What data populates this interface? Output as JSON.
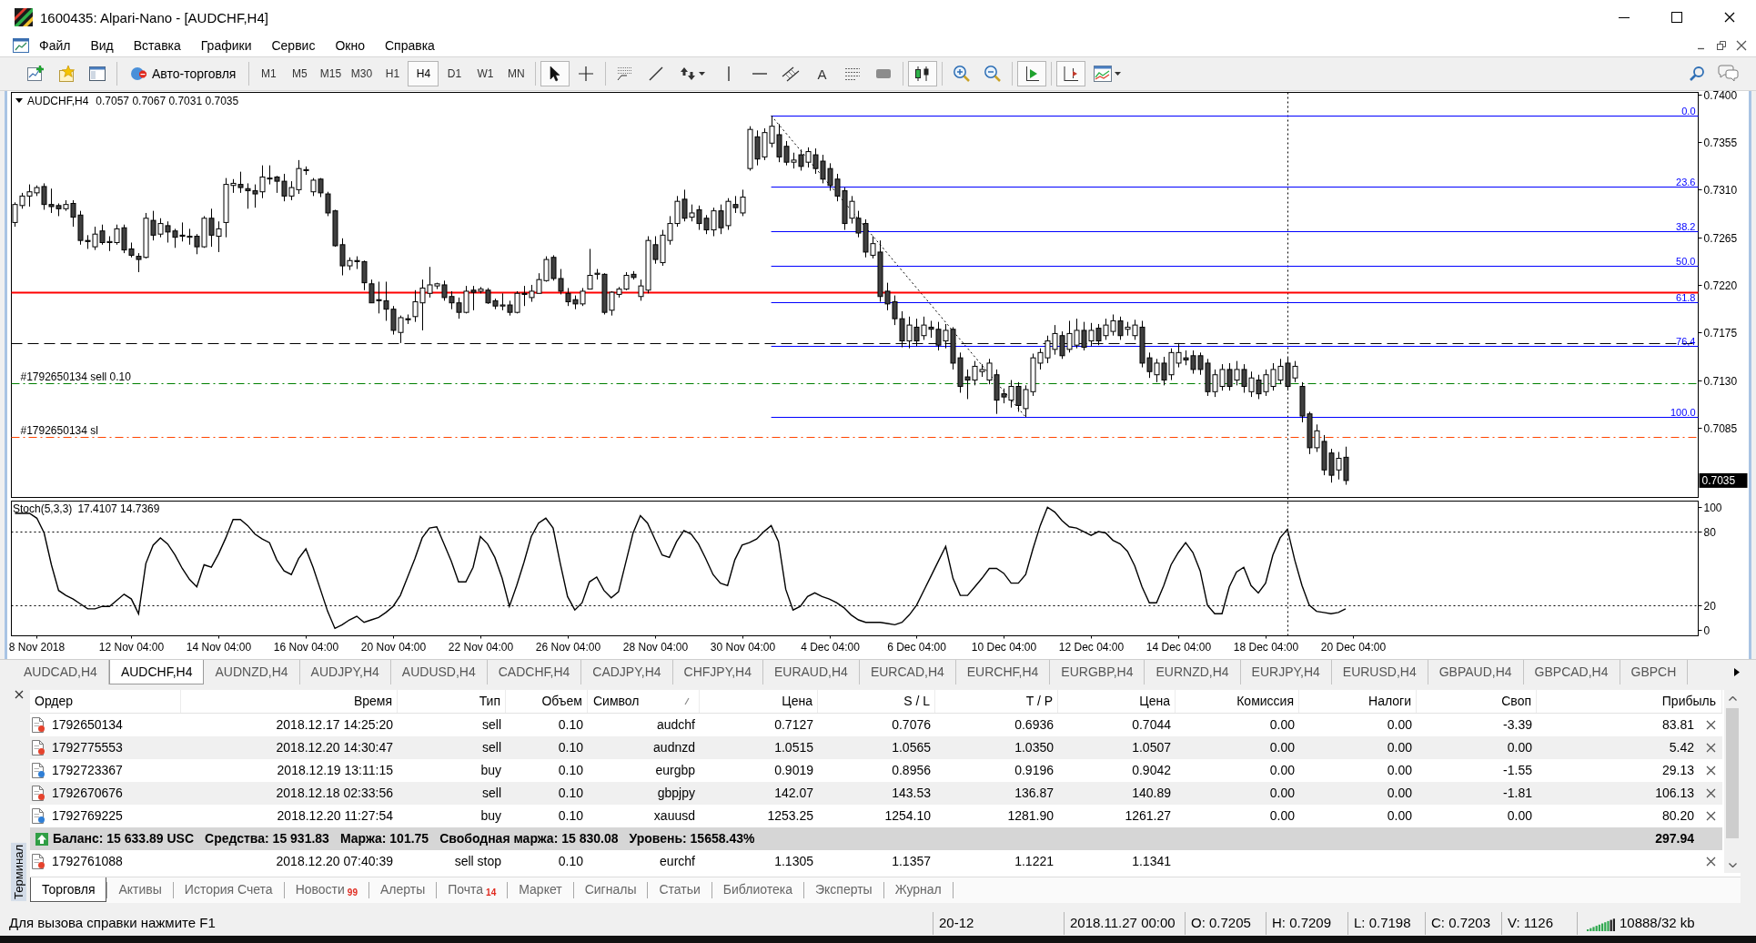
{
  "window": {
    "title": "1600435: Alpari-Nano - [AUDCHF,H4]"
  },
  "menu": [
    "Файл",
    "Вид",
    "Вставка",
    "Графики",
    "Сервис",
    "Окно",
    "Справка"
  ],
  "toolbar": {
    "auto_trading": "Авто-торговля",
    "timeframes": [
      {
        "label": "M1",
        "selected": false
      },
      {
        "label": "M5",
        "selected": false
      },
      {
        "label": "M15",
        "selected": false
      },
      {
        "label": "M30",
        "selected": false
      },
      {
        "label": "H1",
        "selected": false
      },
      {
        "label": "H4",
        "selected": true
      },
      {
        "label": "D1",
        "selected": false
      },
      {
        "label": "W1",
        "selected": false
      },
      {
        "label": "MN",
        "selected": false
      }
    ],
    "cursor_tools": [
      {
        "selected": true
      },
      {
        "selected": false
      }
    ],
    "text_tool": "A",
    "toggles": [
      {
        "on": true
      },
      {
        "on": true
      },
      {
        "on": true
      }
    ]
  },
  "chart": {
    "header": {
      "symbol": "AUDCHF,H4",
      "prices": "0.7057 0.7067 0.7031 0.7035"
    },
    "chart_data": [
      {
        "type": "candlestick",
        "ylim": [
          0.7019,
          0.7402
        ],
        "tick_labels": "y",
        "yticks": [
          {
            "value": 0.74,
            "label": "0.7400"
          },
          {
            "value": 0.7355,
            "label": "0.7355"
          },
          {
            "value": 0.731,
            "label": "0.7310"
          },
          {
            "value": 0.7265,
            "label": "0.7265"
          },
          {
            "value": 0.722,
            "label": "0.7220"
          },
          {
            "value": 0.7175,
            "label": "0.7175"
          },
          {
            "value": 0.713,
            "label": "0.7130"
          },
          {
            "value": 0.7085,
            "label": "0.7085"
          }
        ],
        "ref_lines": [
          {
            "axis": "y",
            "value": 0.738,
            "color": "#0000ff",
            "line_style": "solid"
          },
          {
            "axis": "y",
            "value": 0.7313,
            "color": "#0000ff",
            "line_style": "solid"
          },
          {
            "axis": "y",
            "value": 0.7271,
            "color": "#0000ff",
            "line_style": "solid"
          },
          {
            "axis": "y",
            "value": 0.7238,
            "color": "#0000ff",
            "line_style": "solid"
          },
          {
            "axis": "y",
            "value": 0.7204,
            "color": "#0000ff",
            "line_style": "solid"
          },
          {
            "axis": "y",
            "value": 0.7162,
            "color": "#0000ff",
            "line_style": "solid"
          },
          {
            "axis": "y",
            "value": 0.7095,
            "color": "#0000ff",
            "line_style": "solid"
          },
          {
            "axis": "y",
            "value": 0.7213,
            "color": "#ff0000",
            "line_style": "solid"
          },
          {
            "axis": "y",
            "value": 0.7165,
            "color": "#000000",
            "line_style": "dashed"
          },
          {
            "axis": "y",
            "value": 0.7127,
            "label": "#1792650134 sell 0.10",
            "color": "#008000",
            "line_style": "dashdot"
          },
          {
            "axis": "y",
            "value": 0.7076,
            "label": "#1792650134 sl",
            "color": "#ff4500",
            "line_style": "dashdot"
          }
        ],
        "annotations": [
          "0.0",
          "23.6",
          "38.2",
          "50.0",
          "61.8",
          "76,4",
          "100.0",
          "0.7035"
        ],
        "ohlc": [
          [
            0.7279,
            0.7298,
            0.7275,
            0.7296
          ],
          [
            0.7295,
            0.7307,
            0.7292,
            0.7304
          ],
          [
            0.7304,
            0.7315,
            0.7294,
            0.7308
          ],
          [
            0.7307,
            0.7314,
            0.7304,
            0.7312
          ],
          [
            0.7313,
            0.7316,
            0.7291,
            0.7296
          ],
          [
            0.7296,
            0.7311,
            0.7288,
            0.7294
          ],
          [
            0.7295,
            0.7297,
            0.7285,
            0.7292
          ],
          [
            0.7292,
            0.73,
            0.729,
            0.7296
          ],
          [
            0.7297,
            0.73,
            0.7275,
            0.7284
          ],
          [
            0.7286,
            0.729,
            0.7258,
            0.7262
          ],
          [
            0.7262,
            0.7267,
            0.7254,
            0.7261
          ],
          [
            0.7256,
            0.7275,
            0.7253,
            0.7268
          ],
          [
            0.7271,
            0.7277,
            0.7258,
            0.726
          ],
          [
            0.726,
            0.7266,
            0.7252,
            0.7261
          ],
          [
            0.726,
            0.7277,
            0.7258,
            0.7273
          ],
          [
            0.7274,
            0.7277,
            0.725,
            0.7253
          ],
          [
            0.7254,
            0.726,
            0.7246,
            0.7248
          ],
          [
            0.7247,
            0.725,
            0.7232,
            0.7244
          ],
          [
            0.7246,
            0.7288,
            0.7245,
            0.7283
          ],
          [
            0.7281,
            0.729,
            0.7262,
            0.7267
          ],
          [
            0.7268,
            0.7283,
            0.7265,
            0.7278
          ],
          [
            0.7276,
            0.728,
            0.726,
            0.727
          ],
          [
            0.7271,
            0.7273,
            0.7255,
            0.7265
          ],
          [
            0.7267,
            0.7279,
            0.7261,
            0.7266
          ],
          [
            0.7265,
            0.7273,
            0.7258,
            0.7266
          ],
          [
            0.7266,
            0.7268,
            0.7249,
            0.7256
          ],
          [
            0.7256,
            0.7285,
            0.7255,
            0.7283
          ],
          [
            0.7283,
            0.7292,
            0.7256,
            0.7267
          ],
          [
            0.7266,
            0.728,
            0.7251,
            0.7273
          ],
          [
            0.7279,
            0.7321,
            0.7265,
            0.7315
          ],
          [
            0.7314,
            0.732,
            0.7307,
            0.7316
          ],
          [
            0.7315,
            0.7327,
            0.7307,
            0.7312
          ],
          [
            0.7311,
            0.7316,
            0.7292,
            0.7309
          ],
          [
            0.7309,
            0.7315,
            0.7293,
            0.7306
          ],
          [
            0.7308,
            0.7333,
            0.7302,
            0.7322
          ],
          [
            0.7321,
            0.7333,
            0.7315,
            0.7321
          ],
          [
            0.7322,
            0.7323,
            0.7307,
            0.7318
          ],
          [
            0.7318,
            0.7325,
            0.7299,
            0.7304
          ],
          [
            0.7304,
            0.7318,
            0.73,
            0.7312
          ],
          [
            0.731,
            0.7338,
            0.7306,
            0.733
          ],
          [
            0.7329,
            0.7332,
            0.7324,
            0.7328
          ],
          [
            0.7308,
            0.7321,
            0.7304,
            0.7319
          ],
          [
            0.732,
            0.7321,
            0.7303,
            0.7307
          ],
          [
            0.7306,
            0.7308,
            0.7285,
            0.7288
          ],
          [
            0.729,
            0.7291,
            0.7256,
            0.7257
          ],
          [
            0.7258,
            0.7264,
            0.7229,
            0.7238
          ],
          [
            0.7238,
            0.7246,
            0.7234,
            0.7243
          ],
          [
            0.7243,
            0.7247,
            0.7235,
            0.7242
          ],
          [
            0.7242,
            0.7243,
            0.7215,
            0.7222
          ],
          [
            0.7221,
            0.7225,
            0.7203,
            0.7203
          ],
          [
            0.7206,
            0.7223,
            0.7193,
            0.7205
          ],
          [
            0.7205,
            0.7223,
            0.7186,
            0.7197
          ],
          [
            0.7197,
            0.72,
            0.7173,
            0.7177
          ],
          [
            0.7175,
            0.7191,
            0.7165,
            0.7189
          ],
          [
            0.7188,
            0.7192,
            0.7183,
            0.7187
          ],
          [
            0.719,
            0.7215,
            0.7185,
            0.7204
          ],
          [
            0.7203,
            0.7225,
            0.7177,
            0.7217
          ],
          [
            0.7212,
            0.7237,
            0.7208,
            0.722
          ],
          [
            0.7219,
            0.7222,
            0.7216,
            0.7221
          ],
          [
            0.722,
            0.7224,
            0.7205,
            0.7208
          ],
          [
            0.7209,
            0.7214,
            0.7197,
            0.7203
          ],
          [
            0.7203,
            0.7208,
            0.7188,
            0.7194
          ],
          [
            0.7194,
            0.7219,
            0.7193,
            0.7214
          ],
          [
            0.7215,
            0.7219,
            0.7196,
            0.7213
          ],
          [
            0.7214,
            0.7218,
            0.7212,
            0.7216
          ],
          [
            0.7215,
            0.7217,
            0.7202,
            0.7203
          ],
          [
            0.7205,
            0.7207,
            0.7197,
            0.72
          ],
          [
            0.72,
            0.7212,
            0.7196,
            0.7201
          ],
          [
            0.7201,
            0.7205,
            0.7191,
            0.7194
          ],
          [
            0.7194,
            0.7214,
            0.7193,
            0.7212
          ],
          [
            0.7212,
            0.7219,
            0.72,
            0.7211
          ],
          [
            0.7208,
            0.722,
            0.7204,
            0.7214
          ],
          [
            0.7212,
            0.7231,
            0.7212,
            0.7225
          ],
          [
            0.7224,
            0.7247,
            0.7223,
            0.7244
          ],
          [
            0.7246,
            0.7248,
            0.7224,
            0.7226
          ],
          [
            0.7226,
            0.7235,
            0.7211,
            0.7214
          ],
          [
            0.7212,
            0.7217,
            0.72,
            0.7204
          ],
          [
            0.7206,
            0.721,
            0.7197,
            0.7202
          ],
          [
            0.7202,
            0.7217,
            0.72,
            0.7214
          ],
          [
            0.7216,
            0.7254,
            0.7216,
            0.7229
          ],
          [
            0.723,
            0.7235,
            0.7225,
            0.7231
          ],
          [
            0.723,
            0.7231,
            0.7192,
            0.7194
          ],
          [
            0.7196,
            0.7214,
            0.7191,
            0.7213
          ],
          [
            0.7211,
            0.7218,
            0.7208,
            0.7216
          ],
          [
            0.7216,
            0.7232,
            0.7215,
            0.7229
          ],
          [
            0.723,
            0.7233,
            0.7225,
            0.7227
          ],
          [
            0.7209,
            0.7225,
            0.7205,
            0.7219
          ],
          [
            0.7215,
            0.7266,
            0.7212,
            0.7262
          ],
          [
            0.7258,
            0.7266,
            0.724,
            0.7244
          ],
          [
            0.7241,
            0.7272,
            0.7238,
            0.7267
          ],
          [
            0.7262,
            0.7285,
            0.7258,
            0.7278
          ],
          [
            0.7278,
            0.7304,
            0.7275,
            0.7299
          ],
          [
            0.7301,
            0.731,
            0.728,
            0.7283
          ],
          [
            0.7284,
            0.7296,
            0.728,
            0.7288
          ],
          [
            0.7291,
            0.7295,
            0.7272,
            0.7278
          ],
          [
            0.7283,
            0.7286,
            0.7268,
            0.7272
          ],
          [
            0.7272,
            0.7293,
            0.7266,
            0.729
          ],
          [
            0.729,
            0.7296,
            0.7268,
            0.7274
          ],
          [
            0.7276,
            0.7302,
            0.7272,
            0.7299
          ],
          [
            0.7296,
            0.7304,
            0.7288,
            0.7293
          ],
          [
            0.7288,
            0.731,
            0.7285,
            0.7303
          ],
          [
            0.733,
            0.737,
            0.7328,
            0.7367
          ],
          [
            0.736,
            0.7366,
            0.7333,
            0.7339
          ],
          [
            0.7341,
            0.7368,
            0.7338,
            0.7364
          ],
          [
            0.7354,
            0.738,
            0.735,
            0.737
          ],
          [
            0.7362,
            0.7372,
            0.7336,
            0.7341
          ],
          [
            0.7351,
            0.7356,
            0.7333,
            0.7336
          ],
          [
            0.7336,
            0.7345,
            0.733,
            0.7338
          ],
          [
            0.7343,
            0.7348,
            0.7328,
            0.7332
          ],
          [
            0.7336,
            0.735,
            0.7331,
            0.7346
          ],
          [
            0.7343,
            0.7349,
            0.7325,
            0.733
          ],
          [
            0.7337,
            0.7343,
            0.7316,
            0.732
          ],
          [
            0.733,
            0.7335,
            0.7309,
            0.7314
          ],
          [
            0.732,
            0.7325,
            0.7299,
            0.7304
          ],
          [
            0.7309,
            0.7312,
            0.7272,
            0.7278
          ],
          [
            0.7283,
            0.7304,
            0.7278,
            0.7299
          ],
          [
            0.7283,
            0.729,
            0.7265,
            0.7269
          ],
          [
            0.7278,
            0.7282,
            0.7246,
            0.7251
          ],
          [
            0.7248,
            0.7266,
            0.7245,
            0.7259
          ],
          [
            0.7251,
            0.7262,
            0.7204,
            0.7209
          ],
          [
            0.7214,
            0.7222,
            0.7196,
            0.7202
          ],
          [
            0.7204,
            0.721,
            0.7182,
            0.7188
          ],
          [
            0.7188,
            0.7195,
            0.7161,
            0.7167
          ],
          [
            0.7167,
            0.719,
            0.716,
            0.7182
          ],
          [
            0.718,
            0.7188,
            0.7162,
            0.7167
          ],
          [
            0.7172,
            0.719,
            0.7168,
            0.7182
          ],
          [
            0.718,
            0.7186,
            0.717,
            0.7178
          ],
          [
            0.7178,
            0.7185,
            0.7158,
            0.7163
          ],
          [
            0.7167,
            0.7183,
            0.716,
            0.7177
          ],
          [
            0.7178,
            0.718,
            0.714,
            0.7146
          ],
          [
            0.7151,
            0.7156,
            0.7118,
            0.7124
          ],
          [
            0.7133,
            0.714,
            0.7112,
            0.713
          ],
          [
            0.713,
            0.7148,
            0.7125,
            0.7143
          ],
          [
            0.7138,
            0.7145,
            0.7133,
            0.714
          ],
          [
            0.713,
            0.715,
            0.7126,
            0.7146
          ],
          [
            0.7135,
            0.714,
            0.7098,
            0.7111
          ],
          [
            0.7117,
            0.7122,
            0.7108,
            0.7114
          ],
          [
            0.7111,
            0.713,
            0.7104,
            0.7124
          ],
          [
            0.7124,
            0.7128,
            0.71,
            0.7106
          ],
          [
            0.7103,
            0.7125,
            0.7095,
            0.7121
          ],
          [
            0.7119,
            0.7155,
            0.7115,
            0.7151
          ],
          [
            0.7146,
            0.716,
            0.714,
            0.7156
          ],
          [
            0.7151,
            0.7172,
            0.7146,
            0.7167
          ],
          [
            0.7159,
            0.7182,
            0.7154,
            0.7174
          ],
          [
            0.7172,
            0.7176,
            0.715,
            0.7153
          ],
          [
            0.7159,
            0.7186,
            0.7156,
            0.7174
          ],
          [
            0.7163,
            0.7188,
            0.716,
            0.7177
          ],
          [
            0.7177,
            0.7185,
            0.7158,
            0.7161
          ],
          [
            0.7167,
            0.7184,
            0.7162,
            0.7177
          ],
          [
            0.7179,
            0.7183,
            0.7163,
            0.7167
          ],
          [
            0.7172,
            0.7188,
            0.7168,
            0.7182
          ],
          [
            0.7176,
            0.7192,
            0.7172,
            0.7186
          ],
          [
            0.7186,
            0.719,
            0.7168,
            0.7172
          ],
          [
            0.7178,
            0.7185,
            0.7172,
            0.718
          ],
          [
            0.7172,
            0.7187,
            0.7168,
            0.7182
          ],
          [
            0.718,
            0.7186,
            0.7142,
            0.7146
          ],
          [
            0.7151,
            0.7156,
            0.7132,
            0.7138
          ],
          [
            0.7135,
            0.715,
            0.7128,
            0.7146
          ],
          [
            0.7146,
            0.7152,
            0.7125,
            0.713
          ],
          [
            0.7135,
            0.716,
            0.713,
            0.7156
          ],
          [
            0.7146,
            0.7165,
            0.7142,
            0.7156
          ],
          [
            0.7151,
            0.7158,
            0.7144,
            0.7149
          ],
          [
            0.7153,
            0.7158,
            0.7136,
            0.714
          ],
          [
            0.7153,
            0.7156,
            0.7135,
            0.714
          ],
          [
            0.7146,
            0.715,
            0.7115,
            0.7119
          ],
          [
            0.7119,
            0.714,
            0.7114,
            0.7135
          ],
          [
            0.7124,
            0.7145,
            0.712,
            0.714
          ],
          [
            0.714,
            0.7146,
            0.712,
            0.7124
          ],
          [
            0.713,
            0.7148,
            0.7125,
            0.714
          ],
          [
            0.714,
            0.7145,
            0.7118,
            0.7124
          ],
          [
            0.7119,
            0.7138,
            0.7114,
            0.7132
          ],
          [
            0.713,
            0.7135,
            0.7112,
            0.7117
          ],
          [
            0.7119,
            0.714,
            0.7115,
            0.7135
          ],
          [
            0.7124,
            0.7146,
            0.712,
            0.714
          ],
          [
            0.713,
            0.715,
            0.7126,
            0.7143
          ],
          [
            0.7146,
            0.7152,
            0.712,
            0.7124
          ],
          [
            0.7132,
            0.7148,
            0.7128,
            0.7143
          ],
          [
            0.7124,
            0.7128,
            0.709,
            0.7096
          ],
          [
            0.7098,
            0.71,
            0.706,
            0.7066
          ],
          [
            0.7066,
            0.7088,
            0.7062,
            0.7082
          ],
          [
            0.7072,
            0.7078,
            0.704,
            0.7045
          ],
          [
            0.7061,
            0.7065,
            0.7033,
            0.704
          ],
          [
            0.7045,
            0.7062,
            0.7036,
            0.7056
          ],
          [
            0.7057,
            0.7067,
            0.7031,
            0.7035
          ],
          null,
          null,
          null,
          null,
          null,
          null,
          null,
          null,
          null,
          null,
          null,
          null,
          null,
          null,
          null,
          null,
          null,
          null,
          null,
          null,
          null,
          null,
          null,
          null,
          null,
          null,
          null,
          null,
          null,
          null,
          null,
          null,
          null,
          null,
          null,
          null,
          null,
          null,
          null,
          null,
          null,
          null,
          null,
          null,
          null,
          null,
          null,
          null
        ]
      },
      {
        "type": "line",
        "title": "Stoch(5,3,3)",
        "subtitle": "17.4107 14.7369",
        "ylim": [
          -5,
          105
        ],
        "yticks": [
          100,
          80,
          20,
          0
        ],
        "color": "#000000",
        "ref_lines": [
          {
            "axis": "y",
            "value": 80,
            "color": "#000000",
            "line_style": "dotted"
          },
          {
            "axis": "y",
            "value": 20,
            "color": "#000000",
            "line_style": "dotted"
          }
        ],
        "categories": [
          null,
          null,
          null,
          "8 Nov 2018",
          null,
          null,
          null,
          null,
          null,
          null,
          null,
          null,
          null,
          null,
          null,
          null,
          "12 Nov 04:00",
          null,
          null,
          null,
          null,
          null,
          null,
          null,
          null,
          null,
          null,
          null,
          "14 Nov 04:00",
          null,
          null,
          null,
          null,
          null,
          null,
          null,
          null,
          null,
          null,
          null,
          "16 Nov 04:00",
          null,
          null,
          null,
          null,
          null,
          null,
          null,
          null,
          null,
          null,
          null,
          "20 Nov 04:00",
          null,
          null,
          null,
          null,
          null,
          null,
          null,
          null,
          null,
          null,
          null,
          "22 Nov 04:00",
          null,
          null,
          null,
          null,
          null,
          null,
          null,
          null,
          null,
          null,
          null,
          "26 Nov 04:00",
          null,
          null,
          null,
          null,
          null,
          null,
          null,
          null,
          null,
          null,
          null,
          "28 Nov 04:00",
          null,
          null,
          null,
          null,
          null,
          null,
          null,
          null,
          null,
          null,
          null,
          "30 Nov 04:00",
          null,
          null,
          null,
          null,
          null,
          null,
          null,
          null,
          null,
          null,
          null,
          "4 Dec 04:00",
          null,
          null,
          null,
          null,
          null,
          null,
          null,
          null,
          null,
          null,
          null,
          "6 Dec 04:00",
          null,
          null,
          null,
          null,
          null,
          null,
          null,
          null,
          null,
          null,
          null,
          "10 Dec 04:00",
          null,
          null,
          null,
          null,
          null,
          null,
          null,
          null,
          null,
          null,
          null,
          "12 Dec 04:00",
          null,
          null,
          null,
          null,
          null,
          null,
          null,
          null,
          null,
          null,
          null,
          "14 Dec 04:00",
          null,
          null,
          null,
          null,
          null,
          null,
          null,
          null,
          null,
          null,
          null,
          "18 Dec 04:00",
          null,
          null,
          null,
          null,
          null,
          null,
          null,
          null,
          null,
          null,
          null,
          "20 Dec 04:00",
          null,
          null,
          null,
          null,
          null,
          null,
          null,
          null,
          null,
          null,
          null,
          null,
          null,
          null,
          null,
          null,
          null,
          null,
          null,
          null,
          null,
          null,
          null,
          null,
          null,
          null,
          null,
          null,
          null,
          null,
          null,
          null,
          null,
          null,
          null,
          null,
          null,
          null,
          null,
          null,
          null,
          null,
          null,
          null,
          null,
          null,
          null
        ],
        "values": [
          95,
          95,
          95,
          91,
          79,
          53,
          32,
          28,
          25,
          21,
          17,
          17,
          19,
          19,
          24,
          29,
          25,
          13,
          54,
          69,
          75,
          70,
          61,
          50,
          41,
          35,
          53,
          51,
          62,
          75,
          90,
          90,
          85,
          78,
          74,
          71,
          57,
          48,
          45,
          58,
          66,
          51,
          33,
          15,
          1,
          4,
          8,
          11,
          6,
          8,
          10,
          14,
          19,
          28,
          43,
          58,
          75,
          83,
          84,
          70,
          56,
          39,
          39,
          51,
          76,
          70,
          59,
          42,
          19,
          36,
          55,
          76,
          87,
          91,
          83,
          54,
          27,
          16,
          22,
          39,
          43,
          32,
          26,
          31,
          55,
          79,
          93,
          87,
          74,
          61,
          59,
          72,
          81,
          78,
          70,
          58,
          45,
          38,
          36,
          57,
          69,
          71,
          74,
          80,
          85,
          72,
          33,
          16,
          19,
          27,
          30,
          27,
          25,
          22,
          18,
          12,
          8,
          6,
          6,
          6,
          5,
          4,
          6,
          12,
          20,
          32,
          44,
          56,
          68,
          42,
          28,
          28,
          35,
          42,
          50,
          50,
          46,
          38,
          38,
          45,
          66,
          85,
          100,
          96,
          89,
          84,
          83,
          80,
          77,
          80,
          79,
          73,
          70,
          64,
          52,
          35,
          22,
          22,
          36,
          53,
          63,
          71,
          63,
          48,
          20,
          13,
          13,
          35,
          47,
          51,
          36,
          30,
          38,
          61,
          75,
          82,
          57,
          36,
          20,
          15,
          14,
          13,
          14,
          17,
          null,
          null,
          null,
          null,
          null,
          null,
          null,
          null,
          null,
          null,
          null,
          null,
          null,
          null,
          null,
          null,
          null,
          null,
          null,
          null,
          null,
          null,
          null,
          null,
          null,
          null,
          null,
          null,
          null,
          null,
          null,
          null,
          null,
          null,
          null,
          null,
          null,
          null,
          null,
          null,
          null,
          null,
          null,
          null,
          null,
          null,
          null,
          null
        ]
      }
    ]
  },
  "chart_tabs": [
    {
      "label": "AUDCAD,H4",
      "selected": false
    },
    {
      "label": "AUDCHF,H4",
      "selected": true
    },
    {
      "label": "AUDNZD,H4",
      "selected": false
    },
    {
      "label": "AUDJPY,H4",
      "selected": false
    },
    {
      "label": "AUDUSD,H4",
      "selected": false
    },
    {
      "label": "CADCHF,H4",
      "selected": false
    },
    {
      "label": "CADJPY,H4",
      "selected": false
    },
    {
      "label": "CHFJPY,H4",
      "selected": false
    },
    {
      "label": "EURAUD,H4",
      "selected": false
    },
    {
      "label": "EURCAD,H4",
      "selected": false
    },
    {
      "label": "EURCHF,H4",
      "selected": false
    },
    {
      "label": "EURGBP,H4",
      "selected": false
    },
    {
      "label": "EURNZD,H4",
      "selected": false
    },
    {
      "label": "EURJPY,H4",
      "selected": false
    },
    {
      "label": "EURUSD,H4",
      "selected": false
    },
    {
      "label": "GBPAUD,H4",
      "selected": false
    },
    {
      "label": "GBPCAD,H4",
      "selected": false
    },
    {
      "label": "GBPCH",
      "selected": false
    }
  ],
  "terminal": {
    "title": "Терминал",
    "columns": [
      {
        "label": "Ордер",
        "sorted": false
      },
      {
        "label": "Время",
        "sorted": false
      },
      {
        "label": "Тип",
        "sorted": false
      },
      {
        "label": "Объем",
        "sorted": false
      },
      {
        "label": "Символ",
        "sorted": true
      },
      {
        "label": "Цена",
        "sorted": false
      },
      {
        "label": "S / L",
        "sorted": false
      },
      {
        "label": "T / P",
        "sorted": false
      },
      {
        "label": "Цена",
        "sorted": false
      },
      {
        "label": "Комиссия",
        "sorted": false
      },
      {
        "label": "Налоги",
        "sorted": false
      },
      {
        "label": "Своп",
        "sorted": false
      },
      {
        "label": "Прибыль",
        "sorted": false
      }
    ],
    "rows": [
      {
        "cells": [
          "1792650134",
          "2018.12.17 14:25:20",
          "sell",
          "0.10",
          "audchf",
          "0.7127",
          "0.7076",
          "0.6936",
          "0.7044",
          "0.00",
          "0.00",
          "-3.39",
          "83.81"
        ],
        "color": "#e5432d"
      },
      {
        "cells": [
          "1792775553",
          "2018.12.20 14:30:47",
          "sell",
          "0.10",
          "audnzd",
          "1.0515",
          "1.0565",
          "1.0350",
          "1.0507",
          "0.00",
          "0.00",
          "0.00",
          "5.42"
        ],
        "color": "#e5432d"
      },
      {
        "cells": [
          "1792723367",
          "2018.12.19 13:11:15",
          "buy",
          "0.10",
          "eurgbp",
          "0.9019",
          "0.8956",
          "0.9196",
          "0.9042",
          "0.00",
          "0.00",
          "-1.55",
          "29.13"
        ],
        "color": "#2f7fd6"
      },
      {
        "cells": [
          "1792670676",
          "2018.12.18 02:33:56",
          "sell",
          "0.10",
          "gbpjpy",
          "142.07",
          "143.53",
          "136.87",
          "140.89",
          "0.00",
          "0.00",
          "-1.81",
          "106.13"
        ],
        "color": "#e5432d"
      },
      {
        "cells": [
          "1792769225",
          "2018.12.20 11:27:54",
          "buy",
          "0.10",
          "xauusd",
          "1253.25",
          "1254.10",
          "1281.90",
          "1261.27",
          "0.00",
          "0.00",
          "0.00",
          "80.20"
        ],
        "color": "#2f7fd6"
      }
    ],
    "summary": {
      "items": [
        "Баланс: 15 633.89 USC",
        "Средства: 15 931.83",
        "Маржа: 101.75",
        "Свободная маржа: 15 830.08",
        "Уровень: 15658.43%"
      ],
      "total": "297.94"
    },
    "pending_rows": [
      {
        "cells": [
          "1792761088",
          "2018.12.20 07:40:39",
          "sell stop",
          "0.10",
          "eurchf",
          "1.1305",
          "1.1357",
          "1.1221",
          "1.1341"
        ],
        "color": "#e5432d"
      }
    ],
    "tabs": [
      {
        "label": "Торговля",
        "selected": true
      },
      {
        "label": "Активы",
        "selected": false
      },
      {
        "label": "История Счета",
        "selected": false
      },
      {
        "label": "Новости",
        "badge": "99",
        "selected": false
      },
      {
        "label": "Алерты",
        "selected": false
      },
      {
        "label": "Почта",
        "badge": "14",
        "selected": false
      },
      {
        "label": "Маркет",
        "selected": false
      },
      {
        "label": "Сигналы",
        "selected": false
      },
      {
        "label": "Статьи",
        "selected": false
      },
      {
        "label": "Библиотека",
        "selected": false
      },
      {
        "label": "Эксперты",
        "selected": false
      },
      {
        "label": "Журнал",
        "selected": false
      }
    ]
  },
  "status_bar": {
    "help": "Для вызова справки нажмите F1",
    "fields": [
      "20-12",
      "2018.11.27 00:00",
      "O: 0.7205",
      "H: 0.7209",
      "L: 0.7198",
      "C: 0.7203",
      "V: 1126"
    ],
    "traffic": "10888/32 kb"
  }
}
